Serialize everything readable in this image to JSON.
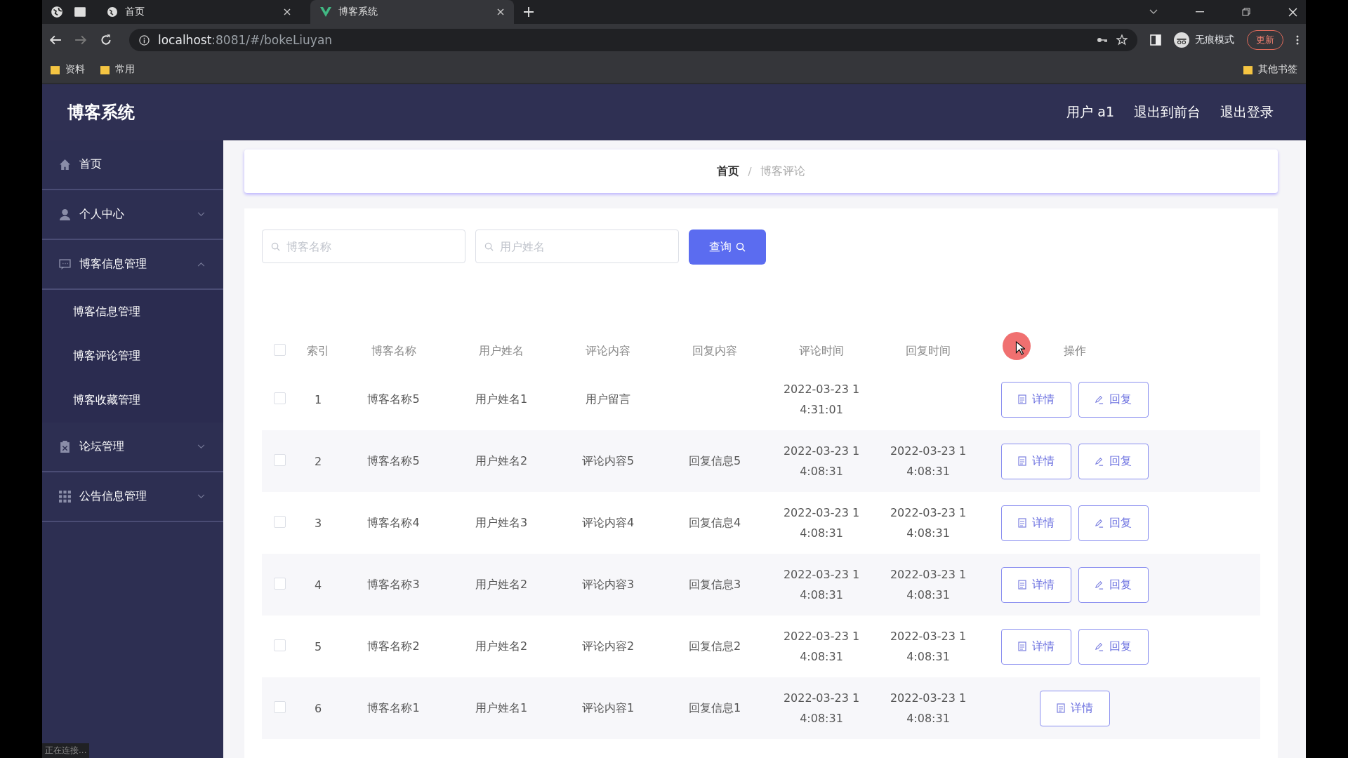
{
  "browser": {
    "tabs": [
      {
        "title": "首页",
        "selected": false
      },
      {
        "title": "博客系统",
        "selected": true
      }
    ],
    "url": {
      "host": "localhost",
      "rest": ":8081/#/bokeLiuyan"
    },
    "incognito": "无痕模式",
    "update": "更新",
    "bookmarks": [
      "资料",
      "常用"
    ],
    "other_bookmarks": "其他书签",
    "status": "正在连接..."
  },
  "app": {
    "title": "博客系统",
    "header_links": [
      "用户 a1",
      "退出到前台",
      "退出登录"
    ]
  },
  "sidebar": {
    "items": [
      {
        "label": "首页",
        "kind": "home",
        "has_arrow": false
      },
      {
        "label": "个人中心",
        "kind": "user",
        "expanded": false,
        "has_arrow": true
      },
      {
        "label": "博客信息管理",
        "kind": "chat",
        "expanded": true,
        "has_arrow": true,
        "children": [
          {
            "label": "博客信息管理"
          },
          {
            "label": "博客评论管理"
          },
          {
            "label": "博客收藏管理"
          }
        ]
      },
      {
        "label": "论坛管理",
        "kind": "clipboard",
        "expanded": false,
        "has_arrow": true
      },
      {
        "label": "公告信息管理",
        "kind": "grid",
        "expanded": false,
        "has_arrow": true
      }
    ]
  },
  "breadcrumb": {
    "items": [
      "首页",
      "博客评论"
    ],
    "separator": "/"
  },
  "search": {
    "fields": [
      {
        "placeholder": "博客名称"
      },
      {
        "placeholder": "用户姓名"
      }
    ],
    "button": "查询"
  },
  "table": {
    "all_checked": false,
    "columns": [
      "索引",
      "博客名称",
      "用户姓名",
      "评论内容",
      "回复内容",
      "评论时间",
      "回复时间",
      "操作"
    ],
    "rows": [
      {
        "checked": false,
        "index": "1",
        "blog": "博客名称5",
        "user": "用户姓名1",
        "comment": "用户留言",
        "comment_time": [
          "2022-03-23 1",
          "4:31:01"
        ],
        "actions": [
          "详情",
          "回复"
        ]
      },
      {
        "checked": false,
        "index": "2",
        "blog": "博客名称5",
        "user": "用户姓名2",
        "comment": "评论内容5",
        "reply": "回复信息5",
        "comment_time": [
          "2022-03-23 1",
          "4:08:31"
        ],
        "reply_time": [
          "2022-03-23 1",
          "4:08:31"
        ],
        "actions": [
          "详情",
          "回复"
        ]
      },
      {
        "checked": false,
        "index": "3",
        "blog": "博客名称4",
        "user": "用户姓名3",
        "comment": "评论内容4",
        "reply": "回复信息4",
        "comment_time": [
          "2022-03-23 1",
          "4:08:31"
        ],
        "reply_time": [
          "2022-03-23 1",
          "4:08:31"
        ],
        "actions": [
          "详情",
          "回复"
        ]
      },
      {
        "checked": false,
        "index": "4",
        "blog": "博客名称3",
        "user": "用户姓名2",
        "comment": "评论内容3",
        "reply": "回复信息3",
        "comment_time": [
          "2022-03-23 1",
          "4:08:31"
        ],
        "reply_time": [
          "2022-03-23 1",
          "4:08:31"
        ],
        "actions": [
          "详情",
          "回复"
        ]
      },
      {
        "checked": false,
        "index": "5",
        "blog": "博客名称2",
        "user": "用户姓名2",
        "comment": "评论内容2",
        "reply": "回复信息2",
        "comment_time": [
          "2022-03-23 1",
          "4:08:31"
        ],
        "reply_time": [
          "2022-03-23 1",
          "4:08:31"
        ],
        "actions": [
          "详情",
          "回复"
        ]
      },
      {
        "checked": false,
        "index": "6",
        "blog": "博客名称1",
        "user": "用户姓名1",
        "comment": "评论内容1",
        "reply": "回复信息1",
        "comment_time": [
          "2022-03-23 1",
          "4:08:31"
        ],
        "reply_time": [
          "2022-03-23 1",
          "4:08:31"
        ],
        "actions": [
          "详情"
        ]
      }
    ]
  }
}
